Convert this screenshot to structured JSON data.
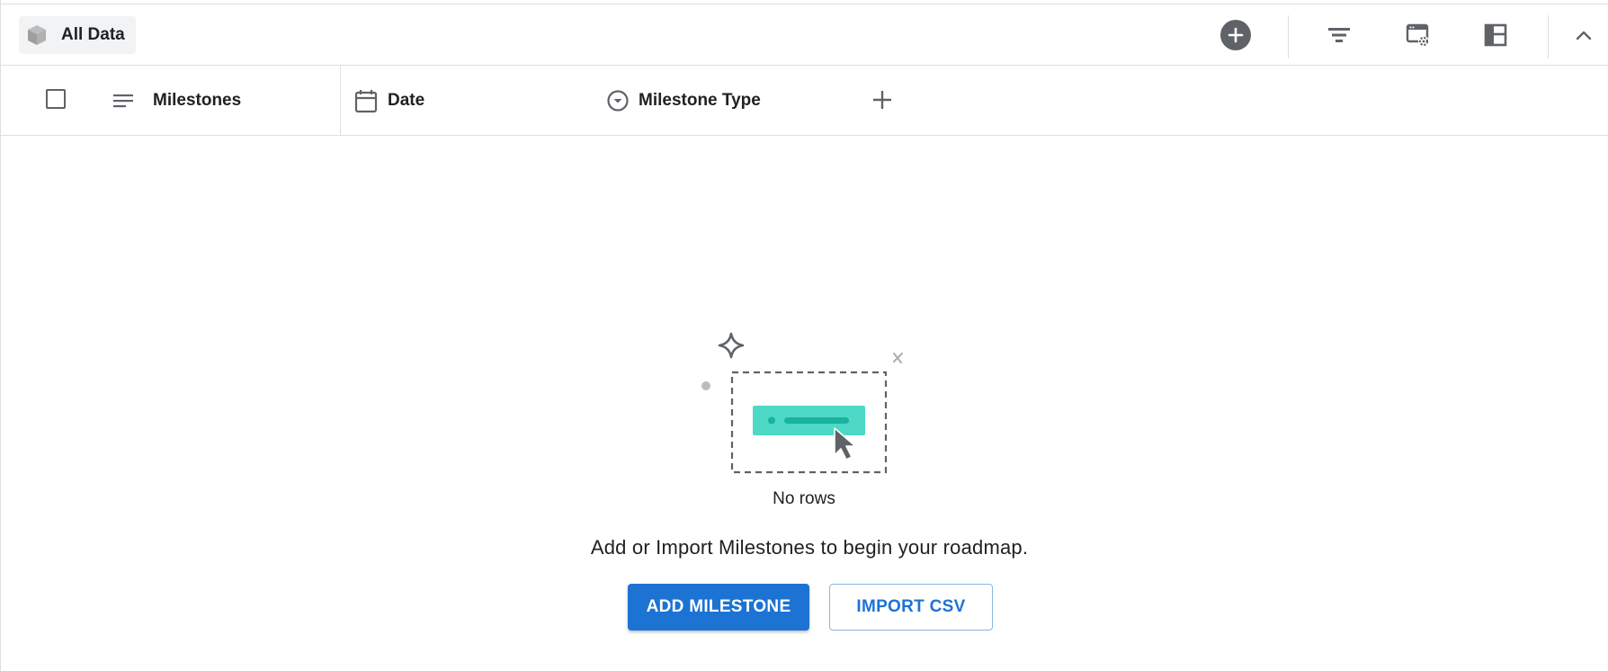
{
  "toolbar": {
    "view_label": "All Data",
    "icons": [
      "cube-icon",
      "add-circle-icon",
      "filter-icon",
      "settings-window-icon",
      "layout-icon",
      "chevron-up-icon"
    ]
  },
  "header": {
    "columns": [
      {
        "icon": "text-lines-icon",
        "label": "Milestones"
      },
      {
        "icon": "calendar-icon",
        "label": "Date"
      },
      {
        "icon": "dropdown-circle-icon",
        "label": "Milestone Type"
      }
    ]
  },
  "empty_state": {
    "title": "No rows",
    "description": "Add or Import Milestones to begin your roadmap.",
    "primary_button": "ADD MILESTONE",
    "secondary_button": "IMPORT CSV"
  },
  "colors": {
    "accent": "#1c73d3",
    "illustration_teal": "#4dd9c6",
    "icon_gray": "#5f6368"
  }
}
